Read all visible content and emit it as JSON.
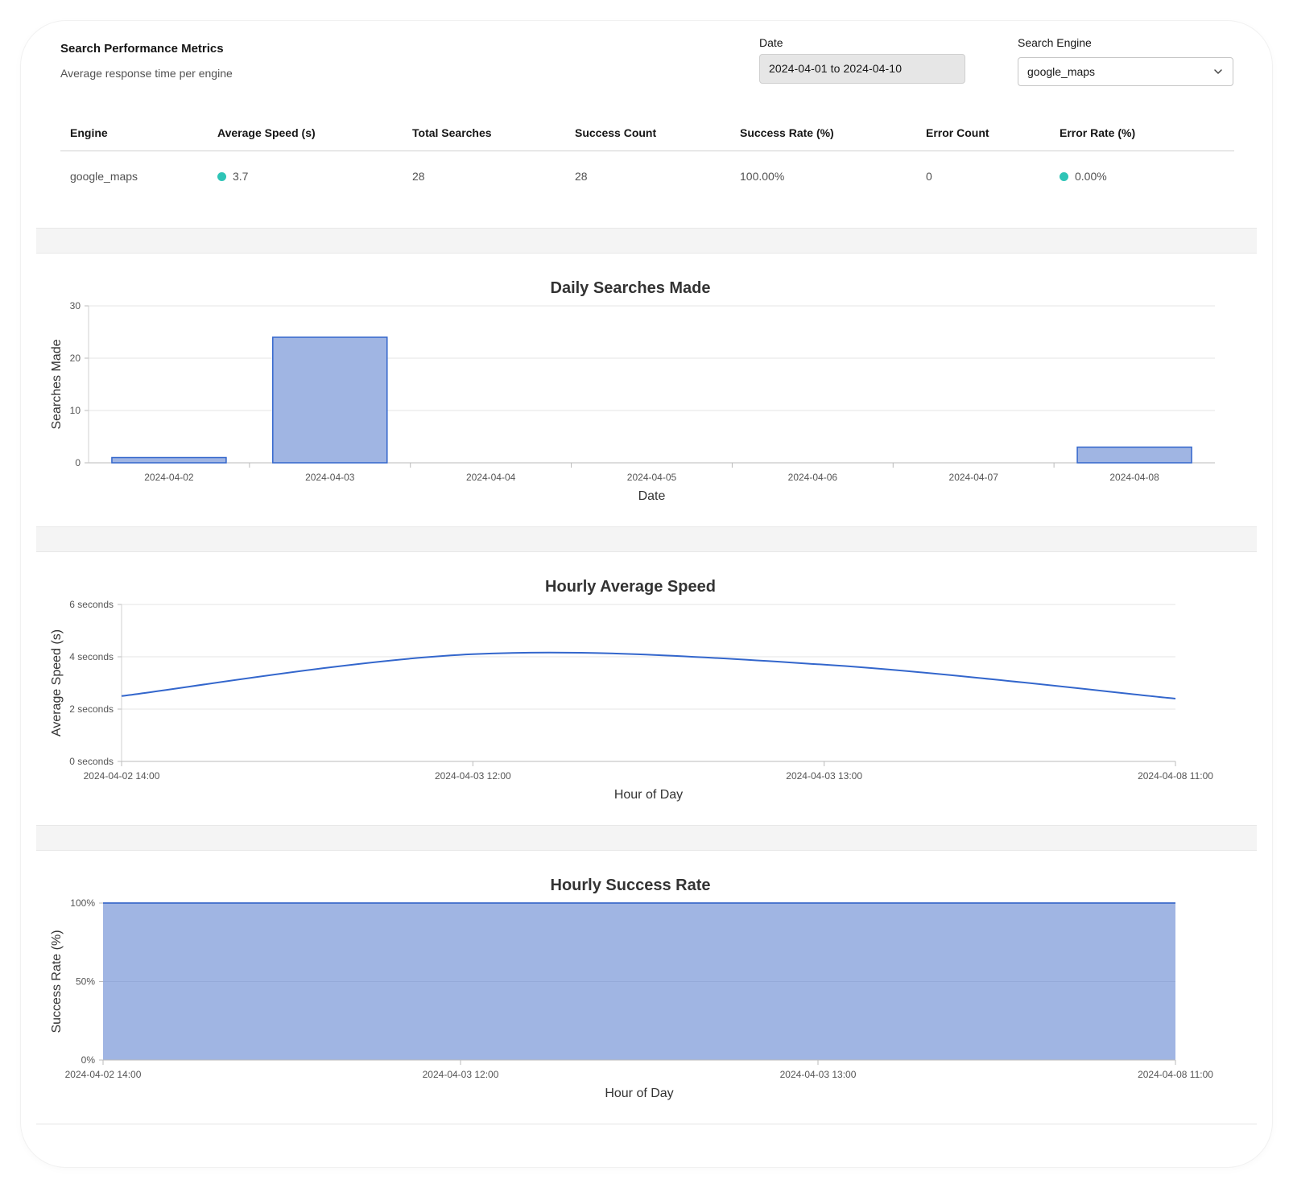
{
  "header": {
    "title": "Search Performance Metrics",
    "subtitle": "Average response time per engine"
  },
  "filters": {
    "date_label": "Date",
    "date_value": "2024-04-01 to 2024-04-10",
    "engine_label": "Search Engine",
    "engine_value": "google_maps"
  },
  "table": {
    "columns": [
      "Engine",
      "Average Speed (s)",
      "Total Searches",
      "Success Count",
      "Success Rate (%)",
      "Error Count",
      "Error Rate (%)"
    ],
    "rows": [
      [
        "google_maps",
        "3.7",
        "28",
        "28",
        "100.00%",
        "0",
        "0.00%"
      ]
    ],
    "status_color": "#2ec4b6"
  },
  "colors": {
    "accent_line": "#3366cc",
    "fill": "#a0b5e3",
    "grid": "#e6e6e6"
  },
  "chart_data": [
    {
      "type": "bar",
      "title": "Daily Searches Made",
      "xlabel": "Date",
      "ylabel": "Searches Made",
      "categories": [
        "2024-04-02",
        "2024-04-03",
        "2024-04-04",
        "2024-04-05",
        "2024-04-06",
        "2024-04-07",
        "2024-04-08"
      ],
      "values": [
        1,
        24,
        0,
        0,
        0,
        0,
        3
      ],
      "ylim": [
        0,
        30
      ],
      "yticks": [
        "0",
        "10",
        "20",
        "30"
      ],
      "grid": true
    },
    {
      "type": "line",
      "title": "Hourly Average Speed",
      "xlabel": "Hour of Day",
      "ylabel": "Average Speed (s)",
      "x": [
        "2024-04-02 14:00",
        "2024-04-03 12:00",
        "2024-04-03 13:00",
        "2024-04-08 11:00"
      ],
      "values": [
        2.5,
        4.1,
        3.7,
        2.4
      ],
      "ylim": [
        0,
        6
      ],
      "yticks": [
        "0 seconds",
        "2 seconds",
        "4 seconds",
        "6 seconds"
      ],
      "grid": true
    },
    {
      "type": "area",
      "title": "Hourly Success Rate",
      "xlabel": "Hour of Day",
      "ylabel": "Success Rate (%)",
      "x": [
        "2024-04-02 14:00",
        "2024-04-03 12:00",
        "2024-04-03 13:00",
        "2024-04-08 11:00"
      ],
      "values": [
        100,
        100,
        100,
        100
      ],
      "ylim": [
        0,
        100
      ],
      "yticks": [
        "0%",
        "50%",
        "100%"
      ],
      "grid": true
    }
  ]
}
